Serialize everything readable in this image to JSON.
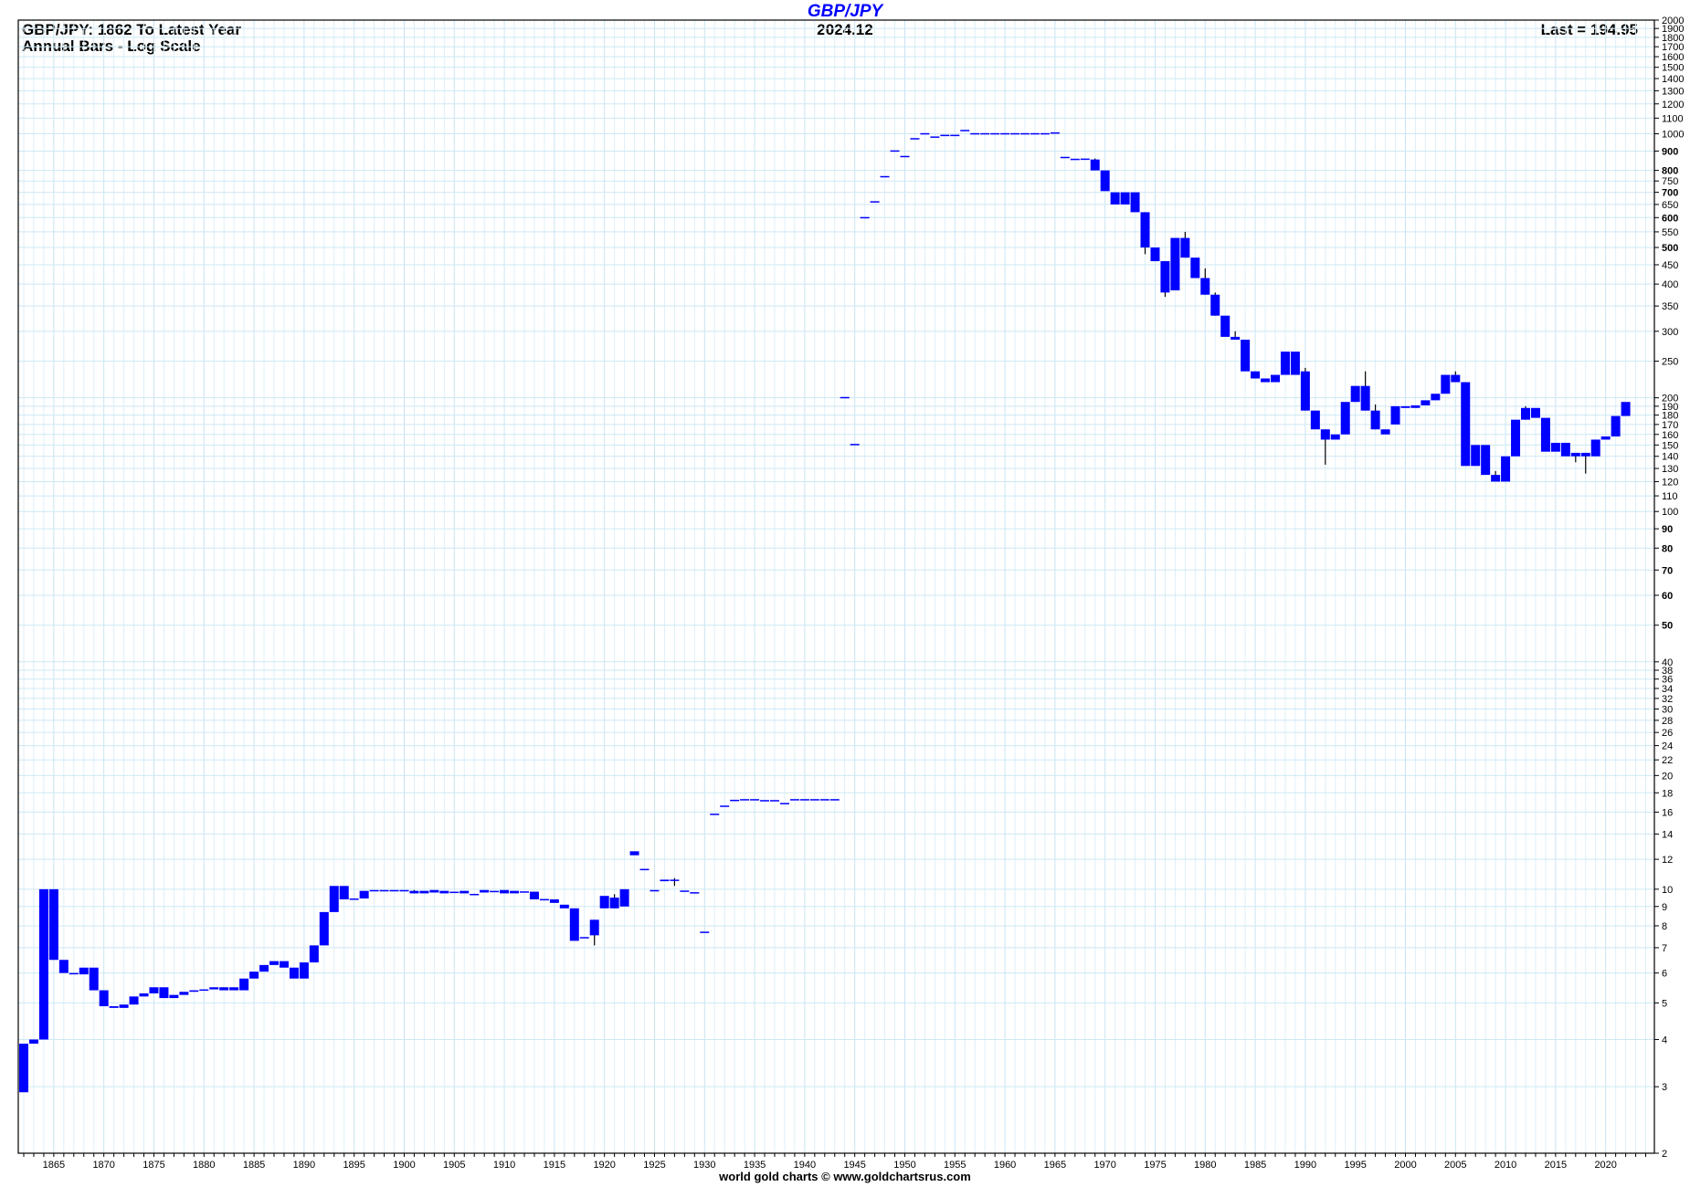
{
  "chart_data": {
    "type": "candlestick",
    "title": "GBP/JPY",
    "subtitle_left": [
      "GBP/JPY: 1862 To Latest Year",
      "Annual Bars - Log Scale"
    ],
    "date": "2024.12",
    "last": "Last = 194.95",
    "footer": "world gold charts © www.goldchartsrus.com",
    "yscale": "log",
    "ylim": [
      2,
      2000
    ],
    "xlim": [
      1862,
      2024
    ],
    "grid": true,
    "bar_color": "#0000ff",
    "y_ticks": [
      2,
      3,
      4,
      5,
      6,
      7,
      8,
      9,
      10,
      12,
      14,
      16,
      18,
      20,
      22,
      24,
      26,
      28,
      30,
      32,
      34,
      36,
      38,
      40,
      50,
      60,
      70,
      80,
      90,
      100,
      110,
      120,
      130,
      140,
      150,
      160,
      170,
      180,
      190,
      200,
      250,
      300,
      350,
      400,
      450,
      500,
      550,
      600,
      650,
      700,
      750,
      800,
      900,
      1000,
      1100,
      1200,
      1300,
      1400,
      1500,
      1600,
      1700,
      1800,
      1900,
      2000
    ],
    "x_ticks": [
      1865,
      1870,
      1875,
      1880,
      1885,
      1890,
      1895,
      1900,
      1905,
      1910,
      1915,
      1920,
      1925,
      1930,
      1935,
      1940,
      1945,
      1950,
      1955,
      1960,
      1965,
      1970,
      1975,
      1980,
      1985,
      1990,
      1995,
      2000,
      2005,
      2010,
      2015,
      2020
    ],
    "bars": [
      [
        1862,
        3.9,
        3.9,
        2.9,
        2.9
      ],
      [
        1863,
        3.9,
        4.0,
        3.9,
        4.0
      ],
      [
        1864,
        4.0,
        10,
        4.0,
        10
      ],
      [
        1865,
        10,
        10,
        6.5,
        6.5
      ],
      [
        1866,
        6.5,
        6.5,
        6.0,
        6.0
      ],
      [
        1867,
        6.0,
        6.0,
        5.95,
        5.95
      ],
      [
        1868,
        5.95,
        6.2,
        5.95,
        6.2
      ],
      [
        1869,
        6.2,
        6.2,
        5.4,
        5.4
      ],
      [
        1870,
        5.4,
        5.4,
        4.9,
        4.9
      ],
      [
        1871,
        4.9,
        4.9,
        4.85,
        4.85
      ],
      [
        1872,
        4.85,
        4.95,
        4.85,
        4.95
      ],
      [
        1873,
        4.95,
        5.2,
        4.95,
        5.2
      ],
      [
        1874,
        5.2,
        5.3,
        5.2,
        5.3
      ],
      [
        1875,
        5.3,
        5.5,
        5.3,
        5.5
      ],
      [
        1876,
        5.5,
        5.5,
        5.15,
        5.15
      ],
      [
        1877,
        5.15,
        5.25,
        5.15,
        5.25
      ],
      [
        1878,
        5.25,
        5.35,
        5.25,
        5.35
      ],
      [
        1879,
        5.35,
        5.4,
        5.35,
        5.4
      ],
      [
        1880,
        5.4,
        5.43,
        5.4,
        5.43
      ],
      [
        1881,
        5.43,
        5.5,
        5.43,
        5.5
      ],
      [
        1882,
        5.5,
        5.5,
        5.4,
        5.4
      ],
      [
        1883,
        5.5,
        5.5,
        5.4,
        5.4
      ],
      [
        1884,
        5.4,
        5.8,
        5.4,
        5.8
      ],
      [
        1885,
        5.8,
        6.05,
        5.8,
        6.05
      ],
      [
        1886,
        6.05,
        6.3,
        6.05,
        6.3
      ],
      [
        1887,
        6.3,
        6.45,
        6.3,
        6.45
      ],
      [
        1888,
        6.45,
        6.45,
        6.2,
        6.2
      ],
      [
        1889,
        6.2,
        6.2,
        5.8,
        5.8
      ],
      [
        1890,
        5.8,
        6.4,
        5.8,
        6.4
      ],
      [
        1891,
        6.4,
        7.1,
        6.4,
        7.1
      ],
      [
        1892,
        7.1,
        8.7,
        7.1,
        8.7
      ],
      [
        1893,
        8.7,
        10.2,
        8.7,
        10.2
      ],
      [
        1894,
        10.2,
        10.2,
        9.4,
        9.4
      ],
      [
        1895,
        9.4,
        9.45,
        9.4,
        9.45
      ],
      [
        1896,
        9.45,
        9.9,
        9.45,
        9.9
      ],
      [
        1897,
        9.9,
        9.95,
        9.9,
        9.95
      ],
      [
        1898,
        9.95,
        9.95,
        9.9,
        9.9
      ],
      [
        1899,
        9.9,
        9.95,
        9.9,
        9.95
      ],
      [
        1900,
        9.95,
        9.95,
        9.9,
        9.9
      ],
      [
        1901,
        9.9,
        9.95,
        9.75,
        9.75
      ],
      [
        1902,
        9.9,
        9.9,
        9.75,
        9.75
      ],
      [
        1903,
        9.95,
        9.95,
        9.8,
        9.8
      ],
      [
        1904,
        9.9,
        9.9,
        9.75,
        9.75
      ],
      [
        1905,
        9.85,
        9.85,
        9.8,
        9.8
      ],
      [
        1906,
        9.9,
        9.9,
        9.75,
        9.75
      ],
      [
        1907,
        9.7,
        9.72,
        9.7,
        9.72
      ],
      [
        1908,
        9.95,
        9.95,
        9.8,
        9.8
      ],
      [
        1909,
        9.9,
        9.9,
        9.85,
        9.85
      ],
      [
        1910,
        9.95,
        9.95,
        9.75,
        9.75
      ],
      [
        1911,
        9.9,
        9.9,
        9.75,
        9.75
      ],
      [
        1912,
        9.85,
        9.87,
        9.85,
        9.87
      ],
      [
        1913,
        9.85,
        9.85,
        9.4,
        9.4
      ],
      [
        1914,
        9.4,
        9.42,
        9.4,
        9.42
      ],
      [
        1915,
        9.4,
        9.4,
        9.2,
        9.2
      ],
      [
        1916,
        9.1,
        9.1,
        8.9,
        8.9
      ],
      [
        1917,
        8.9,
        8.9,
        7.3,
        7.3
      ],
      [
        1918,
        7.45,
        7.47,
        7.45,
        7.47
      ],
      [
        1919,
        8.3,
        8.3,
        7.1,
        7.55
      ],
      [
        1920,
        8.9,
        9.6,
        8.9,
        9.6
      ],
      [
        1921,
        9.5,
        9.7,
        8.9,
        8.9
      ],
      [
        1922,
        9.0,
        10.0,
        9.0,
        10.0
      ],
      [
        1923,
        12.6,
        12.6,
        12.3,
        12.3
      ],
      [
        1924,
        11.3,
        11.32,
        11.3,
        11.32
      ],
      [
        1925,
        9.9,
        9.95,
        9.9,
        9.95
      ],
      [
        1926,
        10.5,
        10.6,
        10.5,
        10.6
      ],
      [
        1927,
        10.6,
        10.7,
        10.2,
        10.6
      ],
      [
        1928,
        9.9,
        9.92,
        9.9,
        9.92
      ],
      [
        1929,
        9.8,
        9.82,
        9.8,
        9.82
      ],
      [
        1930,
        7.7,
        7.72,
        7.7,
        7.72
      ],
      [
        1931,
        15.8,
        15.85,
        15.8,
        15.85
      ],
      [
        1932,
        16.6,
        16.65,
        16.6,
        16.65
      ],
      [
        1933,
        17.2,
        17.25,
        17.2,
        17.25
      ],
      [
        1934,
        17.3,
        17.32,
        17.3,
        17.32
      ],
      [
        1935,
        17.3,
        17.32,
        17.3,
        17.32
      ],
      [
        1936,
        17.2,
        17.22,
        17.2,
        17.22
      ],
      [
        1937,
        17.2,
        17.22,
        17.2,
        17.22
      ],
      [
        1938,
        16.9,
        16.92,
        16.9,
        16.92
      ],
      [
        1939,
        17.3,
        17.32,
        17.3,
        17.32
      ],
      [
        1940,
        17.3,
        17.32,
        17.3,
        17.32
      ],
      [
        1941,
        17.3,
        17.32,
        17.3,
        17.32
      ],
      [
        1942,
        17.3,
        17.32,
        17.3,
        17.32
      ],
      [
        1943,
        17.3,
        17.32,
        17.3,
        17.32
      ],
      [
        1944,
        200,
        201,
        200,
        201
      ],
      [
        1945,
        150,
        151,
        150,
        151
      ],
      [
        1946,
        600,
        602,
        600,
        602
      ],
      [
        1947,
        660,
        663,
        660,
        663
      ],
      [
        1948,
        770,
        773,
        770,
        773
      ],
      [
        1949,
        900,
        904,
        900,
        904
      ],
      [
        1950,
        870,
        874,
        870,
        874
      ],
      [
        1951,
        970,
        974,
        970,
        974
      ],
      [
        1952,
        1000,
        1004,
        1000,
        1004
      ],
      [
        1953,
        980,
        984,
        980,
        984
      ],
      [
        1954,
        990,
        994,
        990,
        994
      ],
      [
        1955,
        990,
        994,
        990,
        994
      ],
      [
        1956,
        1020,
        1024,
        1020,
        1024
      ],
      [
        1957,
        1000,
        1004,
        1000,
        1004
      ],
      [
        1958,
        1000,
        1004,
        1000,
        1004
      ],
      [
        1959,
        1000,
        1004,
        1000,
        1004
      ],
      [
        1960,
        1000,
        1004,
        1000,
        1004
      ],
      [
        1961,
        1000,
        1004,
        1000,
        1004
      ],
      [
        1962,
        1000,
        1004,
        1000,
        1004
      ],
      [
        1963,
        1000,
        1004,
        1000,
        1004
      ],
      [
        1964,
        1000,
        1004,
        1000,
        1004
      ],
      [
        1965,
        1005,
        1009,
        1005,
        1009
      ],
      [
        1966,
        865,
        869,
        865,
        869
      ],
      [
        1967,
        855,
        859,
        855,
        859
      ],
      [
        1968,
        855,
        860,
        855,
        860
      ],
      [
        1969,
        855,
        860,
        800,
        800
      ],
      [
        1970,
        800,
        800,
        705,
        705
      ],
      [
        1971,
        700,
        700,
        650,
        650
      ],
      [
        1972,
        700,
        700,
        650,
        650
      ],
      [
        1973,
        700,
        700,
        620,
        620
      ],
      [
        1974,
        620,
        620,
        480,
        500
      ],
      [
        1975,
        500,
        500,
        460,
        460
      ],
      [
        1976,
        460,
        460,
        370,
        380
      ],
      [
        1977,
        385,
        530,
        385,
        530
      ],
      [
        1978,
        530,
        550,
        470,
        470
      ],
      [
        1979,
        470,
        470,
        415,
        415
      ],
      [
        1980,
        415,
        440,
        375,
        375
      ],
      [
        1981,
        375,
        380,
        330,
        330
      ],
      [
        1982,
        330,
        330,
        290,
        290
      ],
      [
        1983,
        290,
        300,
        285,
        285
      ],
      [
        1984,
        285,
        285,
        235,
        235
      ],
      [
        1985,
        235,
        235,
        225,
        225
      ],
      [
        1986,
        225,
        225,
        220,
        220
      ],
      [
        1987,
        220,
        230,
        220,
        230
      ],
      [
        1988,
        265,
        265,
        230,
        230
      ],
      [
        1989,
        265,
        265,
        230,
        230
      ],
      [
        1990,
        235,
        240,
        185,
        185
      ],
      [
        1991,
        185,
        185,
        165,
        165
      ],
      [
        1992,
        165,
        165,
        133,
        155
      ],
      [
        1993,
        155,
        160,
        155,
        160
      ],
      [
        1994,
        160,
        195,
        160,
        195
      ],
      [
        1995,
        195,
        215,
        195,
        215
      ],
      [
        1996,
        215,
        235,
        185,
        185
      ],
      [
        1997,
        185,
        192,
        165,
        165
      ],
      [
        1998,
        165,
        165,
        160,
        160
      ],
      [
        1999,
        170,
        190,
        170,
        190
      ],
      [
        2000,
        190,
        190,
        188,
        188
      ],
      [
        2001,
        188,
        191,
        188,
        191
      ],
      [
        2002,
        191,
        197,
        191,
        197
      ],
      [
        2003,
        197,
        205,
        197,
        205
      ],
      [
        2004,
        205,
        230,
        205,
        230
      ],
      [
        2005,
        230,
        235,
        220,
        220
      ],
      [
        2006,
        220,
        220,
        132,
        132
      ],
      [
        2007,
        132,
        150,
        132,
        150
      ],
      [
        2008,
        150,
        150,
        125,
        125
      ],
      [
        2009,
        125,
        128,
        120,
        120
      ],
      [
        2010,
        120,
        140,
        120,
        140
      ],
      [
        2011,
        140,
        175,
        140,
        175
      ],
      [
        2012,
        175,
        190,
        175,
        188
      ],
      [
        2013,
        188,
        188,
        177,
        177
      ],
      [
        2014,
        177,
        177,
        144,
        144
      ],
      [
        2015,
        144,
        152,
        144,
        152
      ],
      [
        2016,
        152,
        152,
        140,
        140
      ],
      [
        2017,
        140,
        143,
        135,
        143
      ],
      [
        2018,
        143,
        143,
        126,
        140
      ],
      [
        2019,
        140,
        155,
        140,
        155
      ],
      [
        2020,
        155,
        158,
        155,
        158
      ],
      [
        2021,
        158,
        179,
        158,
        179
      ],
      [
        2022,
        179,
        195,
        179,
        195
      ]
    ]
  }
}
